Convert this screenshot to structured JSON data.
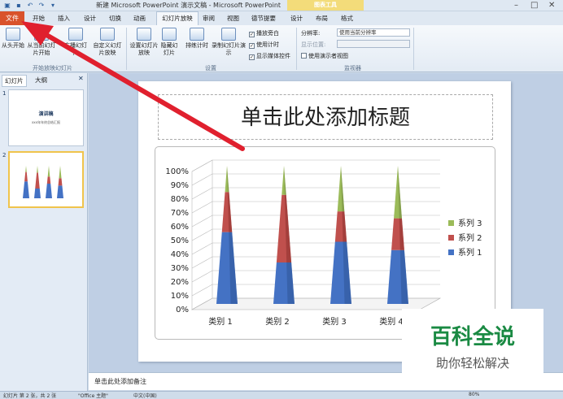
{
  "app_title": "新建 Microsoft PowerPoint 演示文稿 - Microsoft PowerPoint",
  "chart_tools_label": "图表工具",
  "tabs": {
    "file": "文件",
    "items": [
      "开始",
      "插入",
      "设计",
      "切换",
      "动画",
      "幻灯片放映",
      "审阅",
      "视图",
      "德节提要",
      "设计",
      "布局",
      "格式"
    ],
    "active": "幻灯片放映"
  },
  "ribbon": {
    "from_start": "从头开始",
    "from_current": "从当前幻灯片开始",
    "broadcast": "广播幻灯片",
    "custom": "自定义幻灯片放映",
    "setup": "设置幻灯片放映",
    "hide": "隐藏幻灯片",
    "rehearse": "排练计时",
    "record": "录制幻灯片演示",
    "chk_narration": "播放旁白",
    "chk_timing": "使用计时",
    "chk_media": "显示媒体控件",
    "resolution_label": "分辨率:",
    "resolution_value": "使用当前分辨率",
    "show_on_label": "显示位置:",
    "presenter_view": "使用演示者视图",
    "group_start": "开始放映幻灯片",
    "group_setup": "设置",
    "group_monitor": "监视器"
  },
  "panel": {
    "tab_slides": "幻灯片",
    "tab_outline": "大纲",
    "slide1_num": "1",
    "slide2_num": "2",
    "slide1_title": "演讲稿",
    "slide1_sub": "xxx年年终总结汇报"
  },
  "slide": {
    "title_placeholder": "单击此处添加标题"
  },
  "notes_placeholder": "单击此处添加备注",
  "status": {
    "slide_info": "幻灯片 第 2 张，共 2 张",
    "theme": "\"Office 主题\"",
    "language": "中文(中国)",
    "zoom": "80%"
  },
  "watermark": {
    "title": "百科全说",
    "subtitle": "助你轻松解决"
  },
  "colors": {
    "file_tab": "#d9522b",
    "series1": "#4472c4",
    "series2": "#c0504d",
    "series3": "#9bbb59",
    "arrow": "#e0202e",
    "watermark_green": "#1a8a43"
  },
  "chart_data": {
    "type": "bar",
    "stacked": "percent",
    "shape": "3d-cone",
    "categories": [
      "类别 1",
      "类别 2",
      "类别 3",
      "类别 4"
    ],
    "series": [
      {
        "name": "系列 1",
        "values": [
          52,
          30,
          45,
          39
        ]
      },
      {
        "name": "系列 2",
        "values": [
          29,
          49,
          22,
          23
        ]
      },
      {
        "name": "系列 3",
        "values": [
          19,
          21,
          33,
          38
        ]
      }
    ],
    "y_ticks": [
      "0%",
      "10%",
      "20%",
      "30%",
      "40%",
      "50%",
      "60%",
      "70%",
      "80%",
      "90%",
      "100%"
    ],
    "ylim": [
      0,
      100
    ],
    "legend": "right",
    "grid": true
  }
}
